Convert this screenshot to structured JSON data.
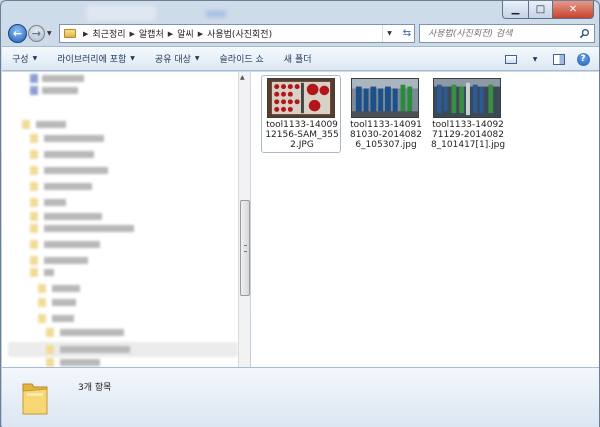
{
  "address": {
    "segments": [
      "최근정리",
      "알캡처",
      "알씨",
      "사용법(사진회전)"
    ]
  },
  "search": {
    "placeholder": "사용법(사진회전) 검색"
  },
  "toolbar": {
    "items": [
      {
        "label": "구성",
        "caret": true
      },
      {
        "label": "라이브러리에 포함",
        "caret": true
      },
      {
        "label": "공유 대상",
        "caret": true
      },
      {
        "label": "슬라이드 쇼",
        "caret": false
      },
      {
        "label": "새 폴더",
        "caret": false
      }
    ]
  },
  "files": [
    {
      "name": "tool1133-1400912156-SAM_3552.JPG",
      "label_lines": [
        "tool1133-14009",
        "12156-SAM_355",
        "2.JPG"
      ],
      "selected": true
    },
    {
      "name": "tool1133-1409181030-20140826_105307.jpg",
      "label_lines": [
        "tool1133-14091",
        "81030-2014082",
        "6_105307.jpg"
      ],
      "selected": false
    },
    {
      "name": "tool1133-1409271129-20140828_101417[1].jpg",
      "label_lines": [
        "tool1133-14092",
        "71129-2014082",
        "8_101417[1].jpg"
      ],
      "selected": false
    }
  ],
  "status": {
    "item_count": "3개 항목"
  },
  "colors": {
    "accent": "#1e5eb8",
    "folder": "#f2cf62",
    "selection_border": "#a9b8cc"
  }
}
